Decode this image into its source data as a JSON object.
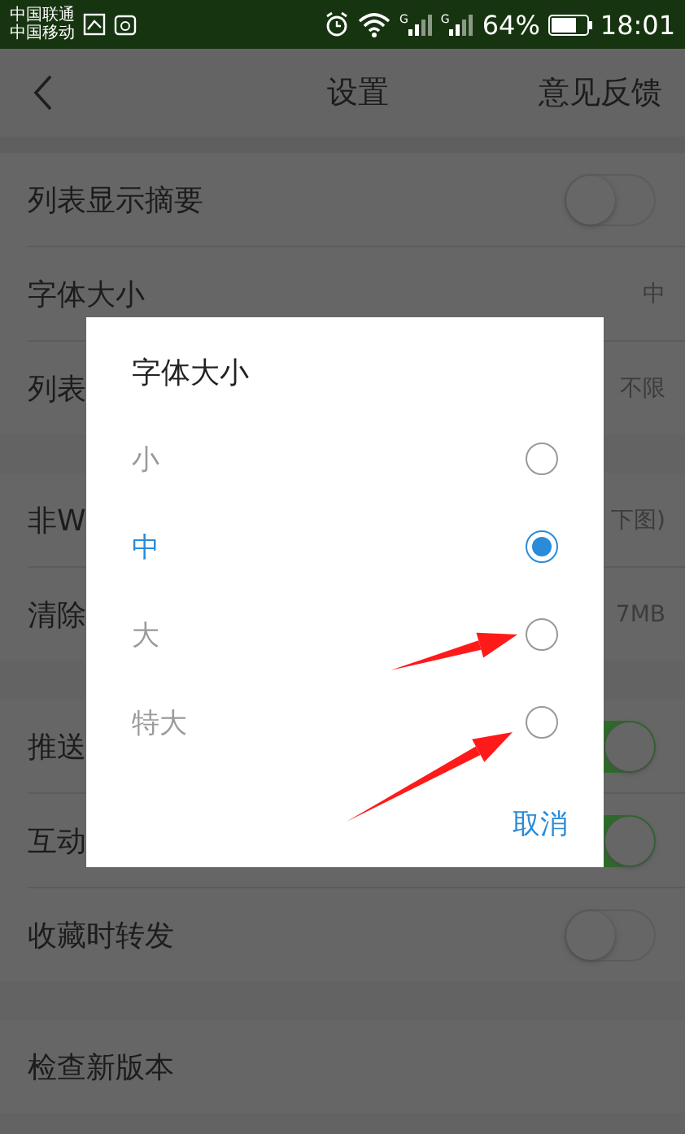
{
  "status_bar": {
    "carriers": [
      "中国联通",
      "中国移动"
    ],
    "network_labels": [
      "G",
      "G"
    ],
    "battery_percent": "64%",
    "time": "18:01"
  },
  "header": {
    "title": "设置",
    "action": "意见反馈"
  },
  "sections": [
    {
      "rows": [
        {
          "kind": "toggle",
          "label": "列表显示摘要",
          "on": false
        },
        {
          "kind": "value",
          "label": "字体大小",
          "value": "中"
        },
        {
          "kind": "value",
          "label": "列表",
          "value": "不限"
        }
      ]
    },
    {
      "rows": [
        {
          "kind": "value",
          "label": "非W",
          "value": "下图)"
        },
        {
          "kind": "value",
          "label": "清除",
          "value": "7MB"
        }
      ]
    },
    {
      "rows": [
        {
          "kind": "toggle",
          "label": "推送",
          "on": true
        },
        {
          "kind": "toggle",
          "label": "互动",
          "on": true
        },
        {
          "kind": "toggle",
          "label": "收藏时转发",
          "on": false
        }
      ]
    },
    {
      "rows": [
        {
          "kind": "plain",
          "label": "检查新版本"
        }
      ]
    }
  ],
  "dialog": {
    "title": "字体大小",
    "options": [
      {
        "label": "小",
        "selected": false
      },
      {
        "label": "中",
        "selected": true
      },
      {
        "label": "大",
        "selected": false
      },
      {
        "label": "特大",
        "selected": false
      }
    ],
    "cancel": "取消"
  }
}
